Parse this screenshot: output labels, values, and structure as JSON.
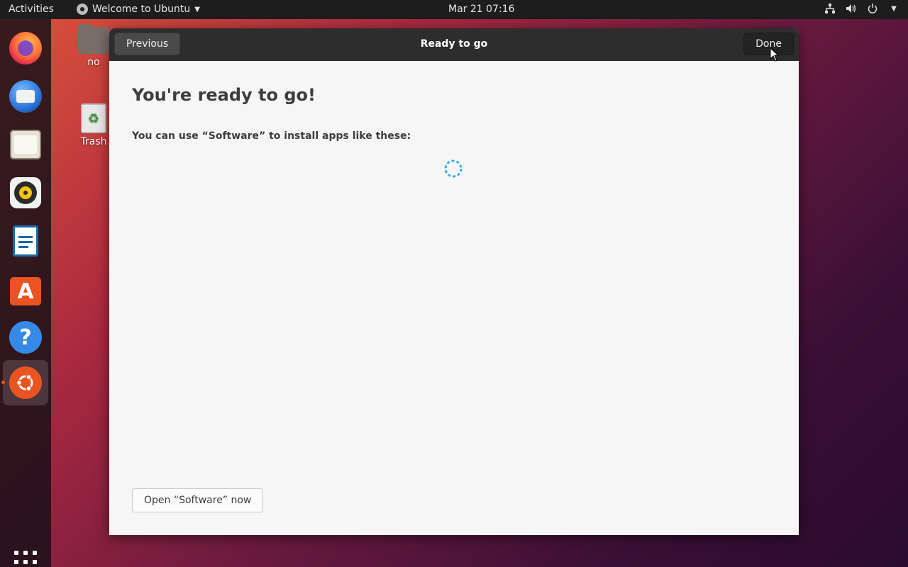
{
  "topbar": {
    "activities": "Activities",
    "app_menu": "Welcome to Ubuntu",
    "clock": "Mar 21  07:16"
  },
  "desktop": {
    "home_label": "no",
    "trash_label": "Trash"
  },
  "dock": {
    "items": [
      "firefox-icon",
      "thunderbird-icon",
      "files-icon",
      "rhythmbox-icon",
      "writer-icon",
      "software-icon",
      "help-icon",
      "ubuntu-icon"
    ],
    "active_item": "ubuntu-icon"
  },
  "window": {
    "title": "Ready to go",
    "previous_label": "Previous",
    "done_label": "Done",
    "heading": "You're ready to go!",
    "subheading": "You can use “Software” to install apps like these:",
    "open_software_label": "Open “Software” now"
  },
  "colors": {
    "topbar": "#1d1d1d",
    "headerbar": "#2d2d2d",
    "window_bg": "#f6f6f6",
    "ubuntu_orange": "#e95420",
    "spinner": "#3daee9"
  }
}
